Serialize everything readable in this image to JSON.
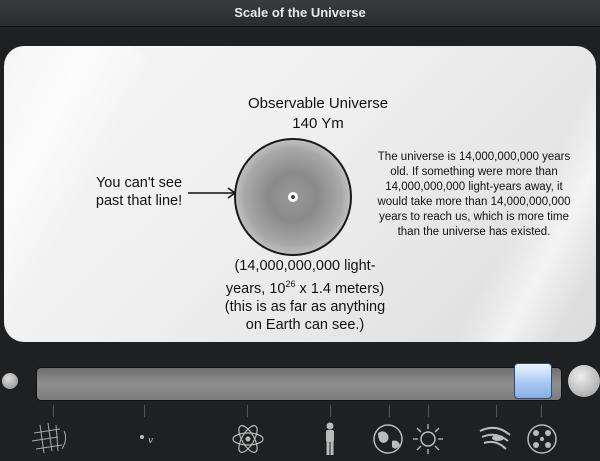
{
  "window": {
    "title": "Scale of the Universe"
  },
  "object": {
    "name": "Observable Universe",
    "size": "140 Ym",
    "callout_line1": "You can't see",
    "callout_line2": "past that line!",
    "info_lines": [
      "The universe is 14,000,000,000 years",
      "old.  If something were more than",
      "14,000,000,000 light-years away, it",
      "would take more than 14,000,000,000",
      "years to reach us, which is more time",
      "than the universe has existed."
    ],
    "distance_line1": "(14,000,000,000 light-",
    "distance_line2_a": "years, 10",
    "distance_line2_exp": "26",
    "distance_line2_b": " x 1.4 meters)",
    "distance_line3": "(this is as far as anything",
    "distance_line4": "on Earth can see.)"
  },
  "zoom": {
    "min_icon": "zoom-out-circle",
    "max_icon": "zoom-in-circle"
  },
  "scale_icons": [
    "quantum-foam-icon",
    "particle-icon",
    "atom-icon",
    "human-icon",
    "earth-icon",
    "sun-icon",
    "galaxy-icon",
    "universe-icon"
  ]
}
